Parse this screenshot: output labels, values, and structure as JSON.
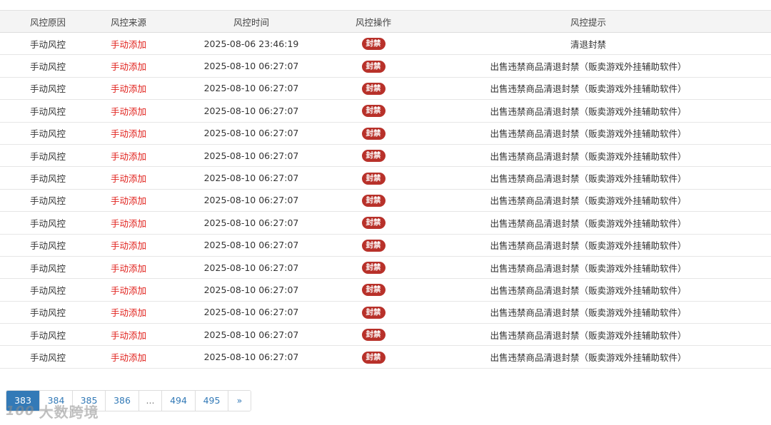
{
  "table": {
    "headers": [
      "风控原因",
      "风控来源",
      "风控时间",
      "风控操作",
      "风控提示"
    ],
    "rows": [
      {
        "reason": "手动风控",
        "source": "手动添加",
        "time": "2025-08-06 23:46:19",
        "action": "封禁",
        "hint": "清退封禁"
      },
      {
        "reason": "手动风控",
        "source": "手动添加",
        "time": "2025-08-10 06:27:07",
        "action": "封禁",
        "hint": "出售违禁商品清退封禁（贩卖游戏外挂辅助软件）"
      },
      {
        "reason": "手动风控",
        "source": "手动添加",
        "time": "2025-08-10 06:27:07",
        "action": "封禁",
        "hint": "出售违禁商品清退封禁（贩卖游戏外挂辅助软件）"
      },
      {
        "reason": "手动风控",
        "source": "手动添加",
        "time": "2025-08-10 06:27:07",
        "action": "封禁",
        "hint": "出售违禁商品清退封禁（贩卖游戏外挂辅助软件）"
      },
      {
        "reason": "手动风控",
        "source": "手动添加",
        "time": "2025-08-10 06:27:07",
        "action": "封禁",
        "hint": "出售违禁商品清退封禁（贩卖游戏外挂辅助软件）"
      },
      {
        "reason": "手动风控",
        "source": "手动添加",
        "time": "2025-08-10 06:27:07",
        "action": "封禁",
        "hint": "出售违禁商品清退封禁（贩卖游戏外挂辅助软件）"
      },
      {
        "reason": "手动风控",
        "source": "手动添加",
        "time": "2025-08-10 06:27:07",
        "action": "封禁",
        "hint": "出售违禁商品清退封禁（贩卖游戏外挂辅助软件）"
      },
      {
        "reason": "手动风控",
        "source": "手动添加",
        "time": "2025-08-10 06:27:07",
        "action": "封禁",
        "hint": "出售违禁商品清退封禁（贩卖游戏外挂辅助软件）"
      },
      {
        "reason": "手动风控",
        "source": "手动添加",
        "time": "2025-08-10 06:27:07",
        "action": "封禁",
        "hint": "出售违禁商品清退封禁（贩卖游戏外挂辅助软件）"
      },
      {
        "reason": "手动风控",
        "source": "手动添加",
        "time": "2025-08-10 06:27:07",
        "action": "封禁",
        "hint": "出售违禁商品清退封禁（贩卖游戏外挂辅助软件）"
      },
      {
        "reason": "手动风控",
        "source": "手动添加",
        "time": "2025-08-10 06:27:07",
        "action": "封禁",
        "hint": "出售违禁商品清退封禁（贩卖游戏外挂辅助软件）"
      },
      {
        "reason": "手动风控",
        "source": "手动添加",
        "time": "2025-08-10 06:27:07",
        "action": "封禁",
        "hint": "出售违禁商品清退封禁（贩卖游戏外挂辅助软件）"
      },
      {
        "reason": "手动风控",
        "source": "手动添加",
        "time": "2025-08-10 06:27:07",
        "action": "封禁",
        "hint": "出售违禁商品清退封禁（贩卖游戏外挂辅助软件）"
      },
      {
        "reason": "手动风控",
        "source": "手动添加",
        "time": "2025-08-10 06:27:07",
        "action": "封禁",
        "hint": "出售违禁商品清退封禁（贩卖游戏外挂辅助软件）"
      },
      {
        "reason": "手动风控",
        "source": "手动添加",
        "time": "2025-08-10 06:27:07",
        "action": "封禁",
        "hint": "出售违禁商品清退封禁（贩卖游戏外挂辅助软件）"
      }
    ]
  },
  "pagination": {
    "pages": [
      "383",
      "384",
      "385",
      "386",
      "...",
      "494",
      "495",
      "»"
    ],
    "active": "383"
  },
  "watermark": {
    "logo": "100",
    "text": "大数跨境"
  },
  "colors": {
    "source_text": "#e0201b",
    "badge": "#b8312a",
    "pager_active": "#337ab7"
  }
}
